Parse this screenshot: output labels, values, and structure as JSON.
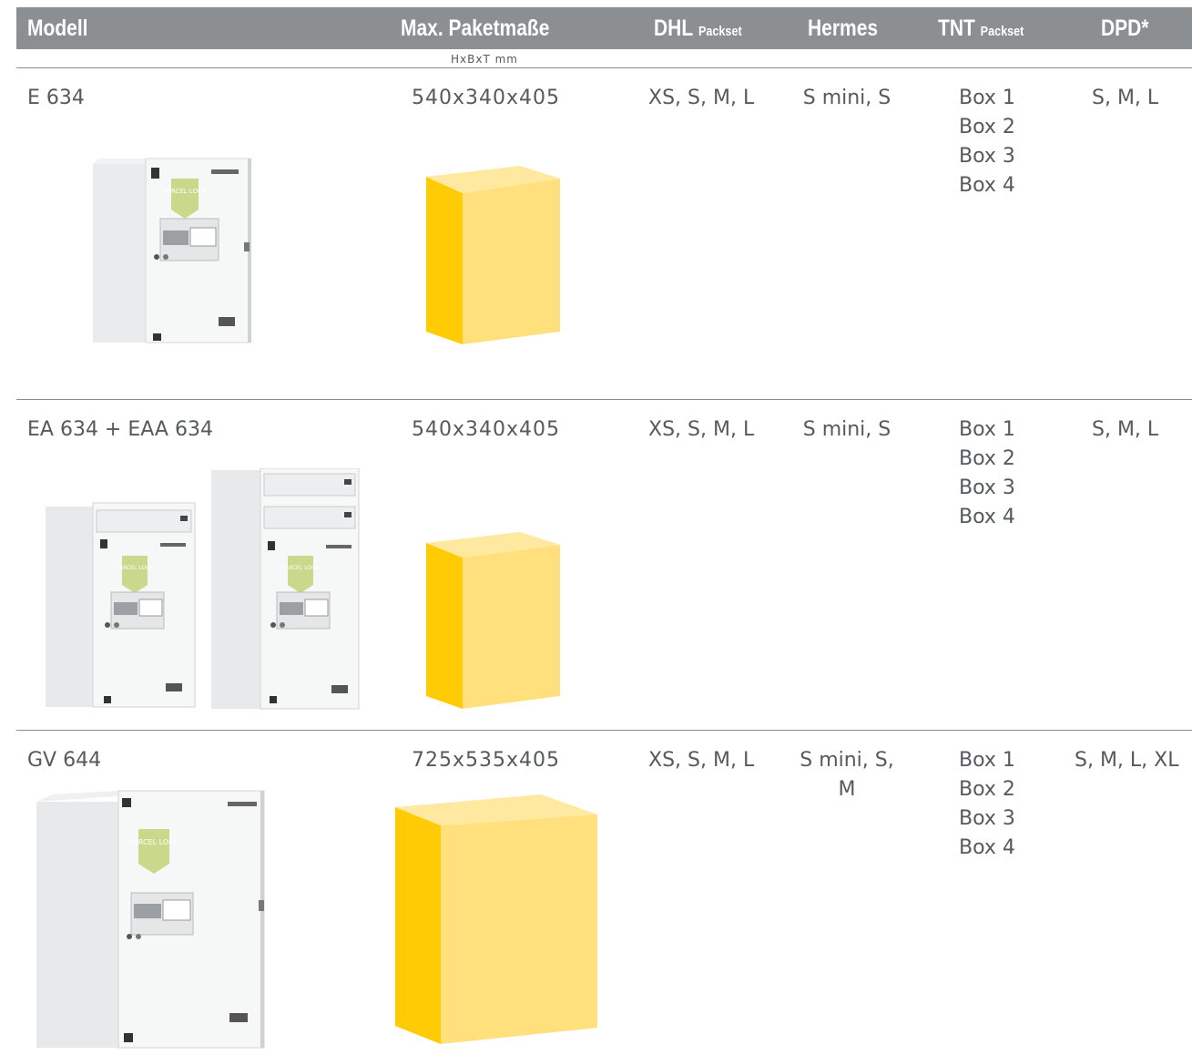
{
  "header": {
    "modell": "Modell",
    "paketmasse": "Max. Paketmaße",
    "dhl": "DHL",
    "dhl_suffix": "Packset",
    "hermes": "Hermes",
    "tnt": "TNT",
    "tnt_suffix": "Packset",
    "dpd": "DPD*"
  },
  "subheader": "HxBxT mm",
  "colors": {
    "header_bg": "#8c8f92",
    "box_side": "#ffcb05",
    "box_front": "#ffe07d",
    "box_top": "#fff3c4"
  },
  "rows": [
    {
      "modell": "E 634",
      "masse": "540x340x405",
      "dhl": "XS, S, M, L",
      "hermes": [
        "S mini, S"
      ],
      "tnt": [
        "Box 1",
        "Box 2",
        "Box 3",
        "Box 4"
      ],
      "dpd": "S, M, L",
      "logo": "PARCEL LOCK"
    },
    {
      "modell": "EA 634 + EAA 634",
      "masse": "540x340x405",
      "dhl": "XS, S, M, L",
      "hermes": [
        "S mini, S"
      ],
      "tnt": [
        "Box 1",
        "Box 2",
        "Box 3",
        "Box 4"
      ],
      "dpd": "S, M, L",
      "logo": "PARCEL LOCK"
    },
    {
      "modell": "GV 644",
      "masse": "725x535x405",
      "dhl": "XS, S, M, L",
      "hermes": [
        "S mini, S,",
        "M"
      ],
      "tnt": [
        "Box 1",
        "Box 2",
        "Box 3",
        "Box 4"
      ],
      "dpd": "S, M, L, XL",
      "logo": "PARCEL LOCK"
    }
  ]
}
